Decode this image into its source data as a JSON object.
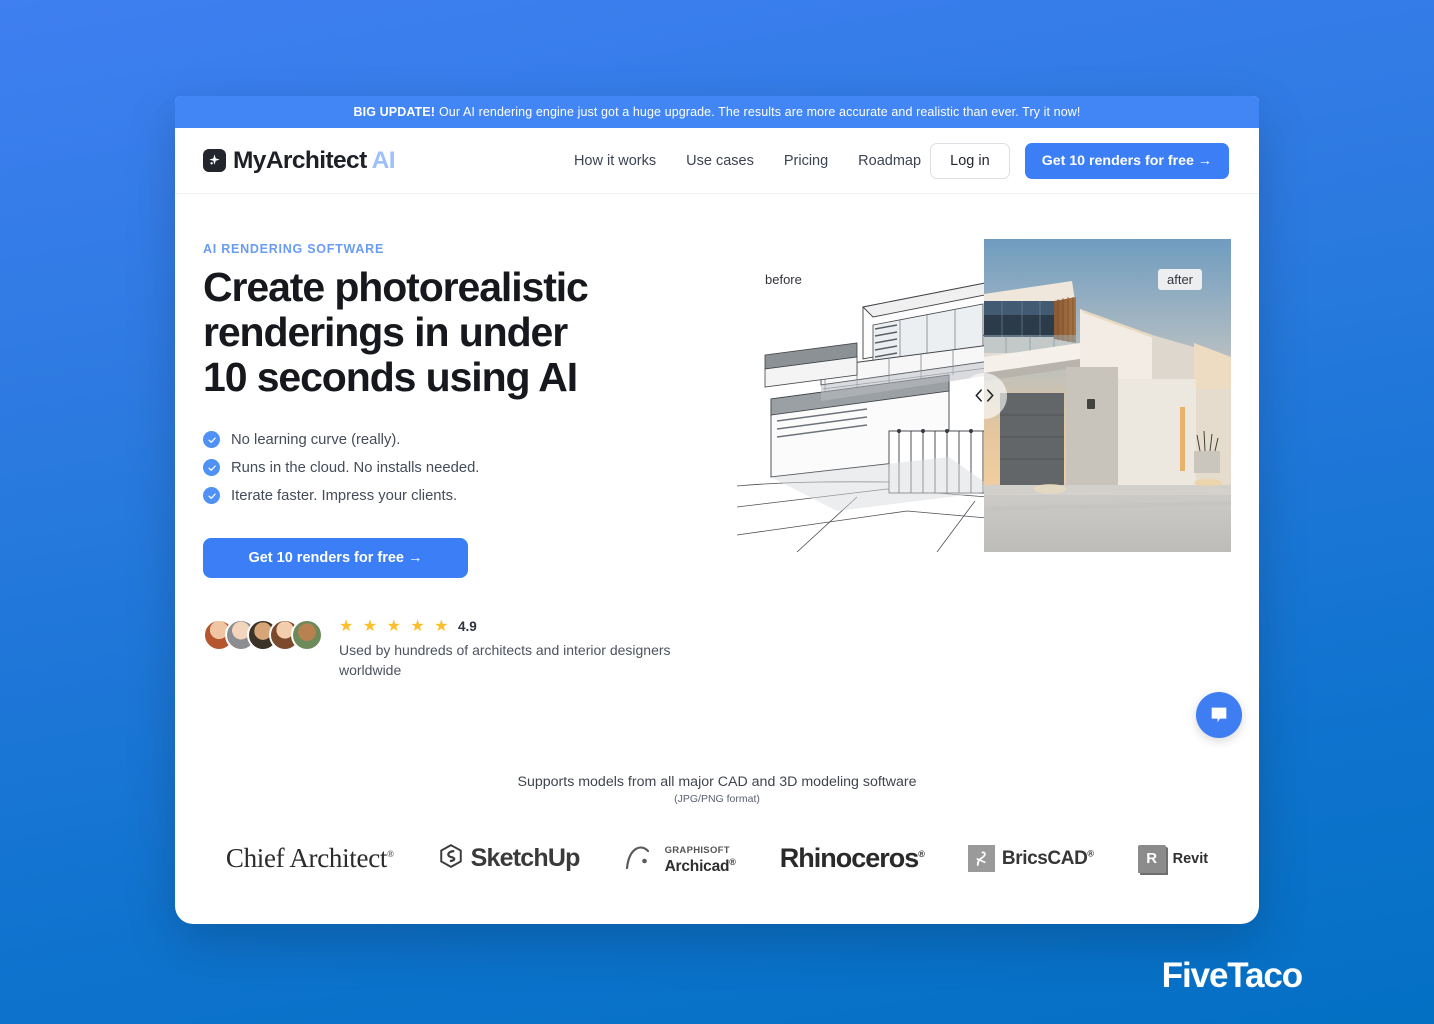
{
  "announcement": {
    "strong": "BIG UPDATE!",
    "text": "Our AI rendering engine just got a huge upgrade. The results are more accurate and realistic than ever. Try it now!"
  },
  "header": {
    "brand_name": "MyArchitect",
    "brand_suffix": "AI",
    "brand_icon": "sparkle-icon",
    "nav": [
      {
        "label": "How it works"
      },
      {
        "label": "Use cases"
      },
      {
        "label": "Pricing"
      },
      {
        "label": "Roadmap"
      }
    ],
    "login_label": "Log in",
    "cta_label": "Get 10 renders for free →"
  },
  "hero": {
    "eyebrow": "AI RENDERING SOFTWARE",
    "title_line1": "Create photorealistic",
    "title_line2": "renderings in under",
    "title_line3": "10 seconds using AI",
    "bullets": [
      {
        "label": "No learning curve (really)."
      },
      {
        "label": "Runs in the cloud. No installs needed."
      },
      {
        "label": "Iterate faster. Impress your clients."
      }
    ],
    "cta_label": "Get 10 renders for free →",
    "rating": {
      "stars": "★ ★ ★ ★ ★",
      "score": "4.9",
      "caption": "Used by hundreds of architects and interior designers worldwide"
    }
  },
  "comparison": {
    "before_label": "before",
    "after_label": "after",
    "handle_icon": "slider-chevrons-icon"
  },
  "chat": {
    "icon": "chat-bubble-icon"
  },
  "logos_section": {
    "headline": "Supports models from all major CAD and 3D modeling software",
    "subline": "(JPG/PNG format)",
    "logos": [
      {
        "name": "Chief Architect",
        "mark": "®"
      },
      {
        "name": "SketchUp",
        "mark": ""
      },
      {
        "name": "Archicad",
        "vendor": "GRAPHISOFT",
        "mark": "®"
      },
      {
        "name": "Rhinoceros",
        "mark": "®"
      },
      {
        "name": "BricsCAD",
        "mark": "®"
      },
      {
        "name": "Revit",
        "mark": ""
      }
    ]
  },
  "watermark": {
    "text": "FiveTaco"
  },
  "colors": {
    "page_gradient_top": "#3f7ff1",
    "page_gradient_bottom": "#0370c4",
    "accent_blue": "#3b7ef6",
    "banner_blue": "#4285f4",
    "star_yellow": "#fbbe2c",
    "eyebrow_blue": "#6a9cf2",
    "brand_dark": "#1d2026"
  }
}
